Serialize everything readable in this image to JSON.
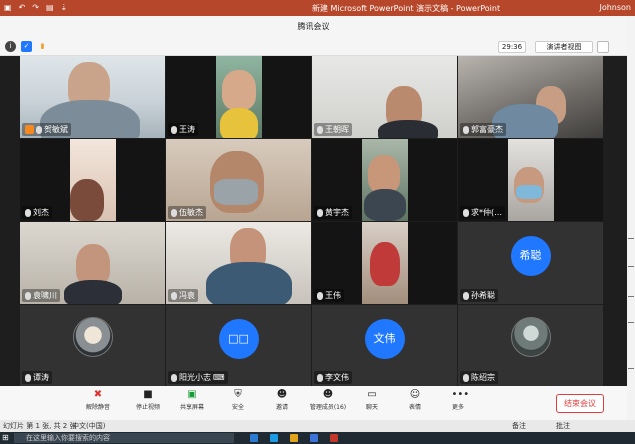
{
  "ppt": {
    "title": "新建 Microsoft PowerPoint 演示文稿  -  PowerPoint",
    "user": "Johnson",
    "status_slide": "幻灯片 第 1 张, 共 2 张",
    "status_lang": "中文(中国)",
    "status_notes": "备注",
    "status_comments": "批注"
  },
  "meeting": {
    "window_title": "腾讯会议",
    "timer": "29:36",
    "presenter_view": "演讲者视图"
  },
  "participants": [
    {
      "name": "贺敏斌",
      "host": true
    },
    {
      "name": "王涛"
    },
    {
      "name": "王朝晖"
    },
    {
      "name": "郭富豪杰"
    },
    {
      "name": "刘杰"
    },
    {
      "name": "伍敏杰"
    },
    {
      "name": "黄宇杰"
    },
    {
      "name": "求*仲(…"
    },
    {
      "name": "袁啸川"
    },
    {
      "name": "冯袁"
    },
    {
      "name": "王伟"
    },
    {
      "name": "孙希聪",
      "avatar_text": "希聪"
    },
    {
      "name": "谭涛"
    },
    {
      "name": "阳光小志",
      "avatar_text": "□□"
    },
    {
      "name": "李文伟",
      "avatar_text": "文伟"
    },
    {
      "name": "陈绍宗"
    }
  ],
  "toolbar": {
    "mute": "解除静音",
    "video": "停止视频",
    "share": "共享屏幕",
    "security": "安全",
    "invite": "邀请",
    "members": "管理成员(16)",
    "chat": "聊天",
    "reactions": "表情",
    "more": "更多",
    "end": "结束会议"
  },
  "taskbar": {
    "search_placeholder": "在这里输入你要搜索的内容"
  },
  "colors": {
    "accent": "#1f78ff",
    "end_red": "#e03e3e",
    "ppt_red": "#b7472a"
  }
}
